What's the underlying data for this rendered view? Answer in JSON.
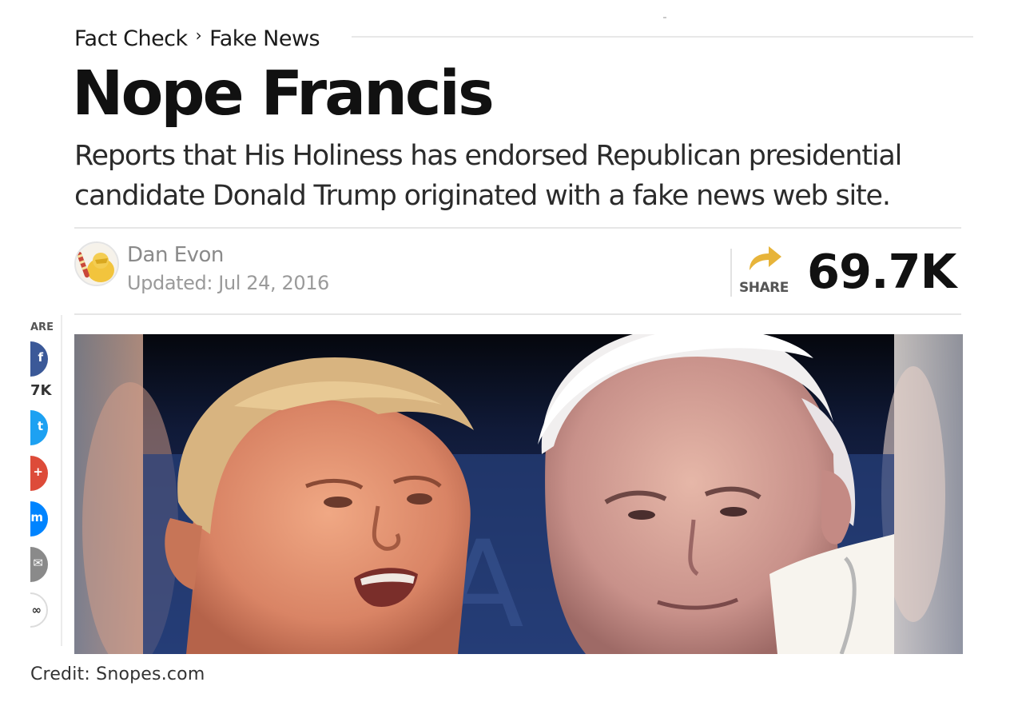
{
  "breadcrumb": {
    "section": "Fact Check",
    "subsection": "Fake News"
  },
  "article": {
    "title": "Nope Francis",
    "dek": "Reports that His Holiness has endorsed Republican presidential candidate Donald Trump originated with a fake news web site.",
    "author": "Dan Evon",
    "updated": "Updated: Jul 24, 2016"
  },
  "share": {
    "label": "SHARE",
    "count": "69.7K",
    "accent": "#e7b43a"
  },
  "rail": {
    "label": "ARE",
    "count": "7K",
    "buttons": [
      {
        "name": "facebook",
        "color": "#3b5998",
        "glyph": "f"
      },
      {
        "name": "twitter",
        "color": "#1da1f2",
        "glyph": "t"
      },
      {
        "name": "google-plus",
        "color": "#dd4b39",
        "glyph": "+"
      },
      {
        "name": "messenger",
        "color": "#0084ff",
        "glyph": "m"
      },
      {
        "name": "email",
        "color": "#8a8a8a",
        "glyph": "✉"
      },
      {
        "name": "link",
        "color": "#ffffff",
        "glyph": "∞"
      }
    ]
  },
  "credit": "Credit: Snopes.com"
}
